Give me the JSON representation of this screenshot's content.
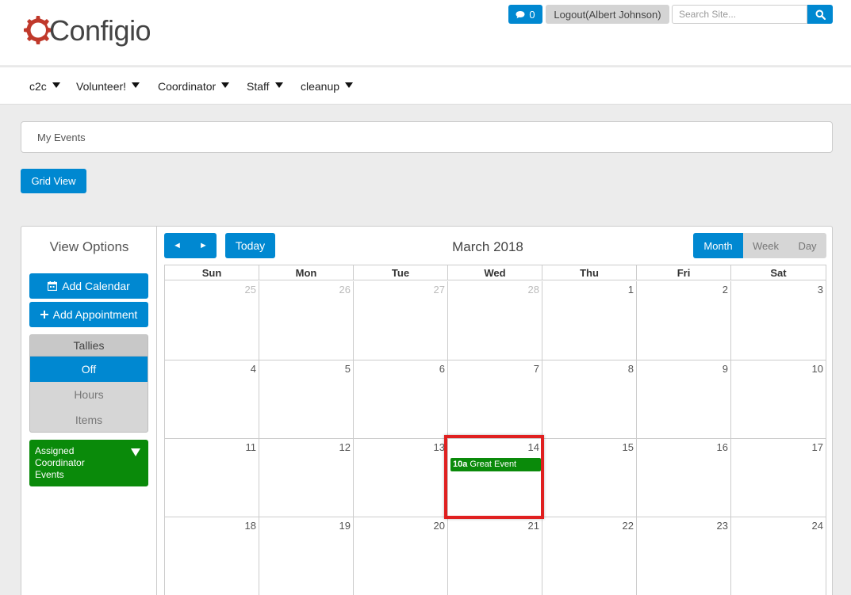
{
  "brand": {
    "name": "Configio",
    "accent": "#0088d1",
    "logo_color": "#c0392b"
  },
  "header": {
    "chat_count": "0",
    "logout_label": "Logout(Albert Johnson)",
    "search_placeholder": "Search Site...",
    "search_value": ""
  },
  "nav": {
    "items": [
      {
        "label": "c2c"
      },
      {
        "label": "Volunteer!"
      },
      {
        "label": "Coordinator"
      },
      {
        "label": "Staff"
      },
      {
        "label": "cleanup"
      }
    ]
  },
  "breadcrumb": {
    "label": "My Events"
  },
  "toolbar": {
    "grid_view_label": "Grid View"
  },
  "sidebar": {
    "title": "View Options",
    "add_calendar_label": "Add Calendar",
    "add_appointment_label": "Add Appointment",
    "tallies": {
      "header": "Tallies",
      "options": [
        {
          "label": "Off",
          "active": true
        },
        {
          "label": "Hours",
          "active": false
        },
        {
          "label": "Items",
          "active": false
        }
      ]
    },
    "assigned_label": "Assigned Coordinator Events",
    "assigned_color": "#0a8a0a"
  },
  "calendar": {
    "title": "March 2018",
    "today_label": "Today",
    "prev_glyph": "◄",
    "next_glyph": "►",
    "views": [
      {
        "label": "Month",
        "active": true
      },
      {
        "label": "Week",
        "active": false
      },
      {
        "label": "Day",
        "active": false
      }
    ],
    "weekdays": [
      "Sun",
      "Mon",
      "Tue",
      "Wed",
      "Thu",
      "Fri",
      "Sat"
    ],
    "weeks": [
      [
        {
          "d": "25",
          "other": true
        },
        {
          "d": "26",
          "other": true
        },
        {
          "d": "27",
          "other": true
        },
        {
          "d": "28",
          "other": true
        },
        {
          "d": "1"
        },
        {
          "d": "2"
        },
        {
          "d": "3"
        }
      ],
      [
        {
          "d": "4"
        },
        {
          "d": "5"
        },
        {
          "d": "6"
        },
        {
          "d": "7"
        },
        {
          "d": "8"
        },
        {
          "d": "9"
        },
        {
          "d": "10"
        }
      ],
      [
        {
          "d": "11"
        },
        {
          "d": "12"
        },
        {
          "d": "13"
        },
        {
          "d": "14",
          "event": {
            "time": "10a",
            "title": "Great Event"
          }
        },
        {
          "d": "15"
        },
        {
          "d": "16"
        },
        {
          "d": "17"
        }
      ],
      [
        {
          "d": "18"
        },
        {
          "d": "19"
        },
        {
          "d": "20"
        },
        {
          "d": "21"
        },
        {
          "d": "22"
        },
        {
          "d": "23"
        },
        {
          "d": "24"
        }
      ]
    ]
  }
}
